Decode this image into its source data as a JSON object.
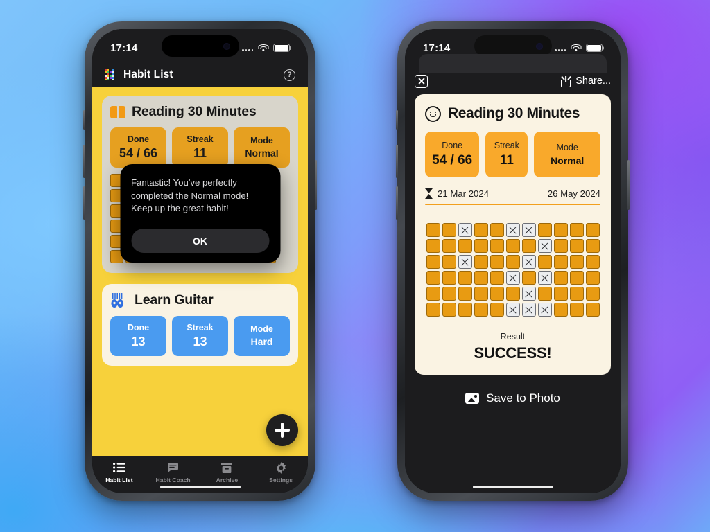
{
  "status_bar": {
    "time": "17:14",
    "wifi_icon": "wifi-icon",
    "battery_icon": "battery-icon",
    "signal_icon": "signal-dots-icon"
  },
  "left_phone": {
    "header": {
      "logo_icon": "habit-list-logo-icon",
      "title": "Habit List",
      "help_icon": "help-circle-icon"
    },
    "habits": [
      {
        "icon": "open-book-icon",
        "name": "Reading 30 Minutes",
        "accent": "#E6A020",
        "stats": [
          {
            "label": "Done",
            "value": "54 / 66"
          },
          {
            "label": "Streak",
            "value": "11"
          },
          {
            "label": "Mode",
            "value": "Normal"
          }
        ]
      },
      {
        "icon": "guitars-icon",
        "name": "Learn Guitar",
        "accent": "#4A9BF0",
        "stats": [
          {
            "label": "Done",
            "value": "13"
          },
          {
            "label": "Streak",
            "value": "13"
          },
          {
            "label": "Mode",
            "value": "Hard"
          }
        ]
      }
    ],
    "dialog": {
      "message": "Fantastic! You've perfectly completed the Normal mode! Keep up the great habit!",
      "ok_label": "OK"
    },
    "fab": {
      "icon": "plus-icon"
    },
    "tabs": [
      {
        "label": "Habit List",
        "icon": "list-icon",
        "active": true
      },
      {
        "label": "Habit Coach",
        "icon": "chat-icon",
        "active": false
      },
      {
        "label": "Archive",
        "icon": "archive-icon",
        "active": false
      },
      {
        "label": "Settings",
        "icon": "gear-icon",
        "active": false
      }
    ]
  },
  "right_phone": {
    "close_icon": "close-box-icon",
    "share_label": "Share...",
    "share_icon": "share-upload-icon",
    "card": {
      "icon": "smiley-face-icon",
      "title": "Reading 30 Minutes",
      "stats": [
        {
          "label": "Done",
          "value": "54 / 66"
        },
        {
          "label": "Streak",
          "value": "11"
        },
        {
          "label": "Mode",
          "value": "Normal"
        }
      ],
      "range_icon": "hourglass-icon",
      "start_date": "21 Mar 2024",
      "end_date": "26 May 2024",
      "result_label": "Result",
      "result_value": "SUCCESS!"
    },
    "save_label": "Save to Photo",
    "save_icon": "photo-icon"
  },
  "chart_data": {
    "type": "heatmap",
    "title": "Reading 30 Minutes habit completion grid",
    "columns": 11,
    "rows": 6,
    "total_cells": 66,
    "done_count": 54,
    "missed_count": 12,
    "legend": {
      "done": "completed (orange square)",
      "missed": "missed (white square with X)"
    },
    "colors": {
      "done": "#E89B12",
      "missed": "#eceef0",
      "card_bg": "#FAF3E3"
    },
    "missed_positions": [
      {
        "row": 1,
        "col": 3
      },
      {
        "row": 1,
        "col": 6
      },
      {
        "row": 1,
        "col": 7
      },
      {
        "row": 2,
        "col": 8
      },
      {
        "row": 3,
        "col": 3
      },
      {
        "row": 3,
        "col": 7
      },
      {
        "row": 4,
        "col": 6
      },
      {
        "row": 4,
        "col": 8
      },
      {
        "row": 5,
        "col": 7
      },
      {
        "row": 6,
        "col": 6
      },
      {
        "row": 6,
        "col": 7
      },
      {
        "row": 6,
        "col": 8
      }
    ],
    "grid": [
      [
        1,
        1,
        0,
        1,
        1,
        0,
        0,
        1,
        1,
        1,
        1
      ],
      [
        1,
        1,
        1,
        1,
        1,
        1,
        1,
        0,
        1,
        1,
        1
      ],
      [
        1,
        1,
        0,
        1,
        1,
        1,
        0,
        1,
        1,
        1,
        1
      ],
      [
        1,
        1,
        1,
        1,
        1,
        0,
        1,
        0,
        1,
        1,
        1
      ],
      [
        1,
        1,
        1,
        1,
        1,
        1,
        0,
        1,
        1,
        1,
        1
      ],
      [
        1,
        1,
        1,
        1,
        1,
        0,
        0,
        0,
        1,
        1,
        1
      ]
    ]
  }
}
